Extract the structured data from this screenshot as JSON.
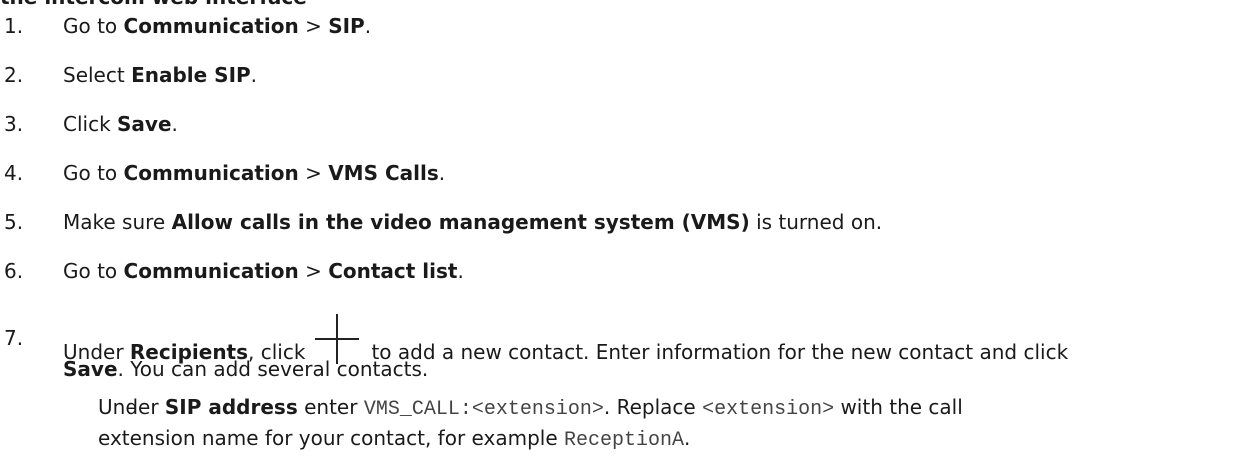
{
  "heading_cut": "the intercom web interface",
  "steps": [
    {
      "num": "1.",
      "pre": "Go to ",
      "b1": "Communication",
      "mid": " > ",
      "b2": "SIP",
      "post": "."
    },
    {
      "num": "2.",
      "pre": "Select ",
      "b1": "Enable SIP",
      "post": "."
    },
    {
      "num": "3.",
      "pre": "Click ",
      "b1": "Save",
      "post": "."
    },
    {
      "num": "4.",
      "pre": "Go to ",
      "b1": "Communication",
      "mid": " > ",
      "b2": "VMS Calls",
      "post": "."
    },
    {
      "num": "5.",
      "pre": "Make sure ",
      "b1": "Allow calls in the video management system (VMS)",
      "post": " is turned on."
    },
    {
      "num": "6.",
      "pre": "Go to ",
      "b1": "Communication",
      "mid": " > ",
      "b2": "Contact list",
      "post": "."
    },
    {
      "num": "7.",
      "pre": "Under ",
      "b1": "Recipients",
      "mid": ", click",
      "post": "to add a new contact. Enter information for the new contact and click",
      "line2_b": "Save",
      "line2_post": ". You can add several contacts."
    }
  ],
  "sub": {
    "dash": "–",
    "pre": "Under ",
    "b": "SIP address",
    "mid": " enter ",
    "code1": "VMS_CALL:<extension>",
    "mid2": ". Replace ",
    "code2": "<extension>",
    "post": " with the call",
    "line2_pre": "extension name for your contact, for example ",
    "code3": "ReceptionA",
    "line2_post": "."
  },
  "icons": {
    "add": "plus-icon"
  }
}
